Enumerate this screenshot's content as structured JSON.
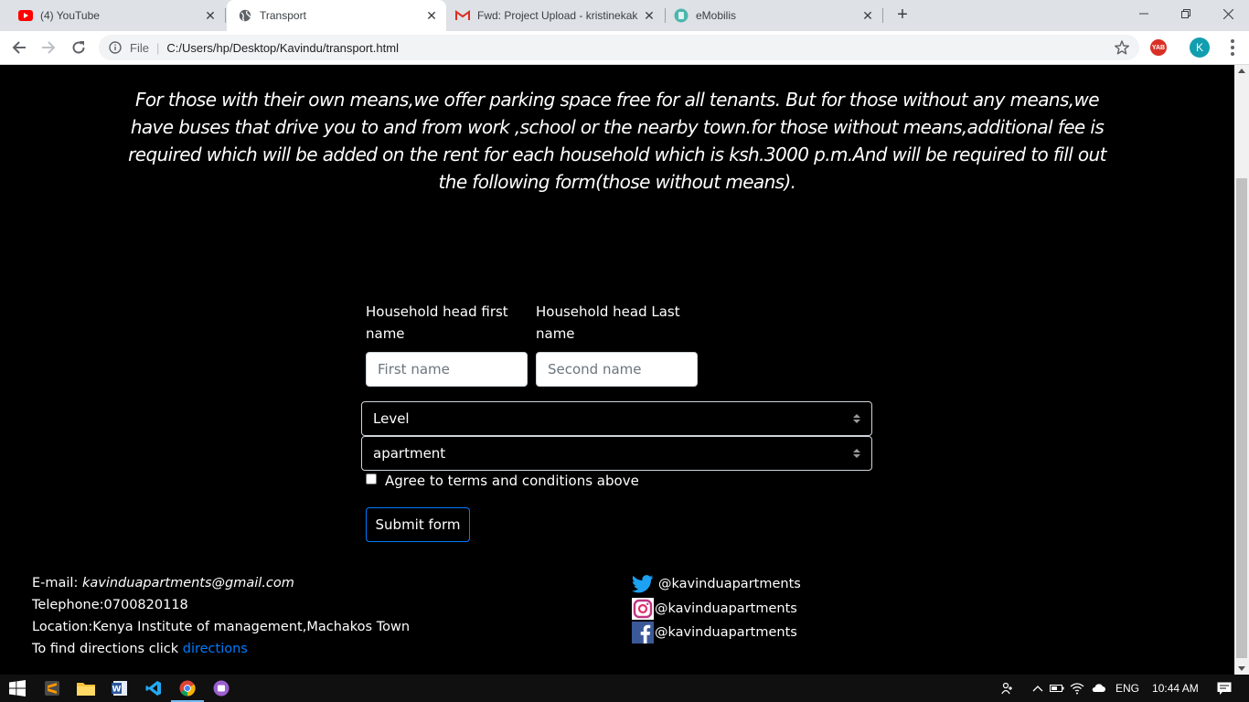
{
  "browser": {
    "tabs": [
      {
        "title": "(4) YouTube",
        "icon": "youtube-icon"
      },
      {
        "title": "Transport",
        "icon": "globe-icon",
        "active": true
      },
      {
        "title": "Fwd: Project Upload - kristinekak",
        "icon": "gmail-icon"
      },
      {
        "title": "eMobilis",
        "icon": "emobilis-icon"
      }
    ],
    "omnibox": {
      "scheme_label": "File",
      "url": "C:/Users/hp/Desktop/Kavindu/transport.html"
    },
    "extension_label": "YAB",
    "profile_initial": "K"
  },
  "page": {
    "intro": "For those with their own means,we offer parking space free for all tenants. But for those without any means,we have buses that drive you to and from work ,school or the nearby town.for those without means,additional fee is required which will be added on the rent for each household which is ksh.3000 p.m.And will be required to fill out the following form(those without means).",
    "form": {
      "first_name_label": "Household head first name",
      "first_name_placeholder": "First name",
      "last_name_label": "Household head Last name",
      "last_name_placeholder": "Second name",
      "level_select": "Level",
      "apartment_select": "apartment",
      "agree_label": "Agree to terms and conditions above",
      "submit_label": "Submit form"
    },
    "footer": {
      "email_label": "E-mail:",
      "email": "kavinduapartments@gmail.com",
      "telephone": "Telephone:0700820118",
      "location": "Location:Kenya Institute of management,Machakos Town",
      "directions_prefix": "To find directions click",
      "directions_link": "directions",
      "twitter": "@kavinduapartments",
      "instagram": "@kavinduapartments",
      "facebook": "@kavinduapartments"
    }
  },
  "taskbar": {
    "language": "ENG",
    "time": "10:44 AM"
  },
  "colors": {
    "page_bg": "#000000",
    "link": "#007bff",
    "twitter": "#1da1f2",
    "facebook": "#3b5998"
  }
}
